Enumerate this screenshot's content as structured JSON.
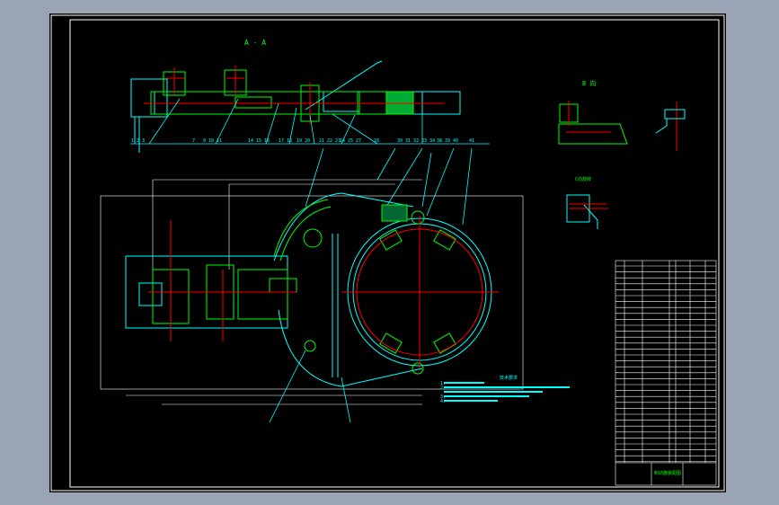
{
  "drawing": {
    "section_label": "A - A",
    "view_b_label": "B 向",
    "view_c_label": "C向旋转",
    "notes_title": "技术要求",
    "notes": [
      "1.",
      "2.",
      "",
      "3.",
      "4."
    ],
    "balloons_top": [
      "1 2 3",
      "7",
      "9 10 11",
      "14 15 16",
      "17 18",
      "19 20",
      "21 22 23",
      "24 25",
      "27",
      "28",
      "30 31 32 33 34",
      "38 39",
      "40",
      "41"
    ],
    "title_block": {
      "drawing_name": "制动器装配图"
    }
  },
  "colors": {
    "background": "#000000",
    "outer": "#9aa4b4",
    "green": "#00ff00",
    "cyan": "#00ffff",
    "red": "#ff0000",
    "white": "#ffffff"
  }
}
